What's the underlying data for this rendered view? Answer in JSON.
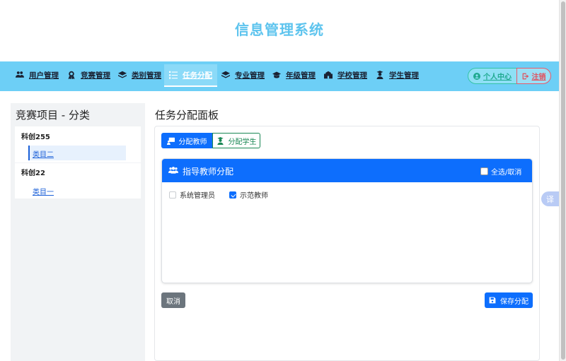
{
  "header": {
    "title": "信息管理系统"
  },
  "nav": {
    "items": [
      {
        "label": "用户管理"
      },
      {
        "label": "竞赛管理"
      },
      {
        "label": "类别管理"
      },
      {
        "label": "任务分配"
      },
      {
        "label": "专业管理"
      },
      {
        "label": "年级管理"
      },
      {
        "label": "学校管理"
      },
      {
        "label": "学生管理"
      }
    ],
    "active": "任务分配",
    "profile_label": "个人中心",
    "logout_label": "注销"
  },
  "sidebar": {
    "title": "竞赛项目 - 分类",
    "groups": [
      {
        "name": "科创255",
        "categories": [
          "类目二"
        ]
      },
      {
        "name": "科创22",
        "categories": [
          "类目一"
        ]
      }
    ],
    "selected": "类目二"
  },
  "main": {
    "title": "任务分配面板",
    "tabs": {
      "teacher": "分配教师",
      "student": "分配学生"
    },
    "card": {
      "title": "指导教师分配",
      "select_all": "全选/取消",
      "options": [
        {
          "label": "系统管理员",
          "checked": false
        },
        {
          "label": "示范教师",
          "checked": true
        }
      ]
    },
    "cancel_label": "取消",
    "save_label": "保存分配"
  },
  "translate_label": "译",
  "colors": {
    "nav_bg": "#6dcff6",
    "primary": "#0d6efd",
    "title": "#5ec4ee",
    "success": "#198754",
    "danger": "#e0525f"
  }
}
